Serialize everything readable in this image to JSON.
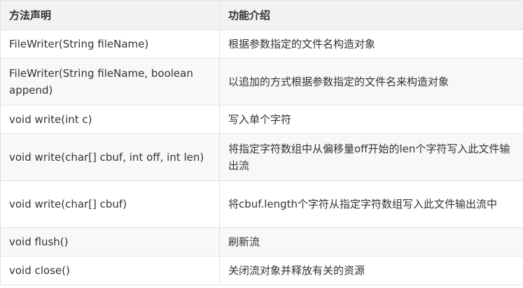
{
  "header": {
    "col1": "方法声明",
    "col2": "功能介绍"
  },
  "rows": [
    {
      "method": "FileWriter(String fileName)",
      "desc": "根据参数指定的文件名构造对象"
    },
    {
      "method": "FileWriter(String fileName, boolean append)",
      "desc": "以追加的方式根据参数指定的文件名来构造对象"
    },
    {
      "method": "void write(int c)",
      "desc": "写入单个字符"
    },
    {
      "method": "void write(char[] cbuf, int off, int len)",
      "desc": "将指定字符数组中从偏移量off开始的len个字符写入此文件输出流"
    },
    {
      "method": "void write(char[] cbuf)",
      "desc": "将cbuf.length个字符从指定字符数组写入此文件输出流中"
    },
    {
      "method": "void flush()",
      "desc": "刷新流"
    },
    {
      "method": "void close()",
      "desc": "关闭流对象并释放有关的资源"
    }
  ]
}
